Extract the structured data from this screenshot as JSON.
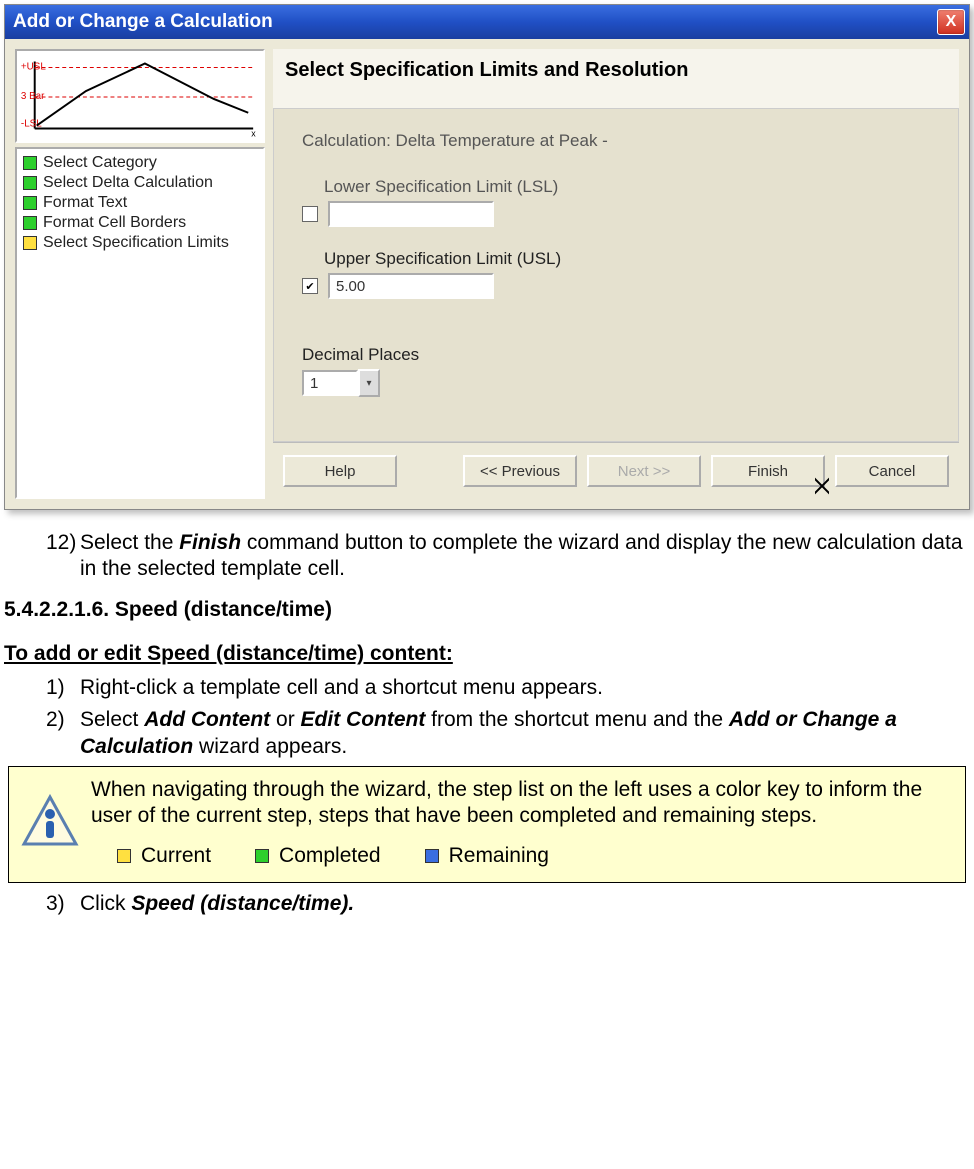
{
  "dialog": {
    "title": "Add or Change a Calculation",
    "close_glyph": "X",
    "header": "Select Specification Limits and Resolution",
    "calc_label": "Calculation: Delta Temperature at Peak -",
    "lsl_label": "Lower Specification Limit (LSL)",
    "lsl_checked": false,
    "lsl_value": "",
    "usl_label": "Upper Specification Limit (USL)",
    "usl_checked": true,
    "usl_value": "5.00",
    "dp_label": "Decimal Places",
    "dp_value": "1",
    "buttons": {
      "help": "Help",
      "prev": "<< Previous",
      "next": "Next >>",
      "finish": "Finish",
      "cancel": "Cancel"
    },
    "steps": [
      {
        "color": "green",
        "label": "Select Category"
      },
      {
        "color": "green",
        "label": "Select Delta Calculation"
      },
      {
        "color": "green",
        "label": "Format Text"
      },
      {
        "color": "green",
        "label": "Format Cell Borders"
      },
      {
        "color": "yellow",
        "label": "Select Specification Limits"
      }
    ]
  },
  "doc": {
    "step12_n": "12)",
    "step12_a": "Select the ",
    "step12_b": "Finish",
    "step12_c": " command button to complete the wizard and display the new calculation data in the selected template cell.",
    "section_no": "5.4.2.2.1.6. Speed (distance/time)",
    "subhead": "To add or edit Speed (distance/time) content:",
    "s1_n": "1)",
    "s1": "Right-click a template cell and a shortcut menu appears.",
    "s2_n": "2)",
    "s2_a": "Select ",
    "s2_b": "Add Content",
    "s2_c": " or ",
    "s2_d": "Edit Content",
    "s2_e": " from the shortcut menu and the ",
    "s2_f": "Add or Change a Calculation",
    "s2_g": " wizard appears.",
    "info_text": "When navigating through the wizard, the step list on the left uses a color key to inform the user of the current step, steps that have been completed and remaining steps.",
    "legend": {
      "current": "Current",
      "completed": "Completed",
      "remaining": "Remaining"
    },
    "s3_n": "3)",
    "s3_a": "Click ",
    "s3_b": "Speed (distance/time)."
  }
}
